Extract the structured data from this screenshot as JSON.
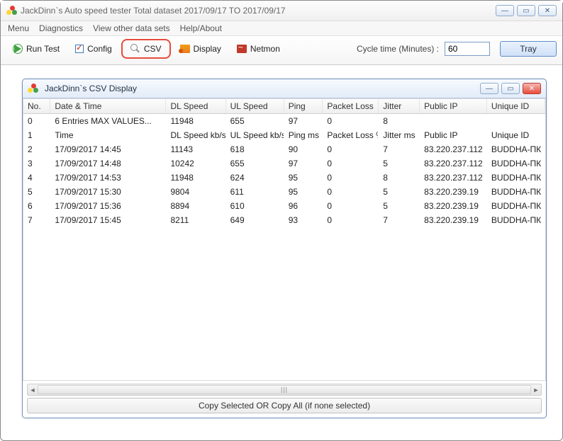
{
  "main": {
    "title": "JackDinn`s Auto speed tester     Total dataset   2017/09/17   TO   2017/09/17"
  },
  "menu": {
    "items": [
      "Menu",
      "Diagnostics",
      "View other data sets",
      "Help/About"
    ]
  },
  "toolbar": {
    "run": "Run Test",
    "config": "Config",
    "csv": "CSV",
    "display": "Display",
    "netmon": "Netmon",
    "cycle_label": "Cycle time (Minutes) :",
    "cycle_value": "60",
    "tray": "Tray"
  },
  "child": {
    "title": "JackDinn`s CSV Display",
    "copy_button": "Copy Selected  OR  Copy All (if none selected)",
    "headers": [
      "No.",
      "Date & Time",
      "DL Speed",
      "UL Speed",
      "Ping",
      "Packet Loss",
      "Jitter",
      "Public IP",
      "Unique ID"
    ],
    "rows": [
      {
        "no": "0",
        "dt": "6 Entries     MAX VALUES...",
        "dl": "11948",
        "ul": "655",
        "ping": "97",
        "pl": "0",
        "jit": "8",
        "ip": "",
        "uid": ""
      },
      {
        "no": "1",
        "dt": "Time",
        "dl": "DL Speed kb/s",
        "ul": "UL Speed kb/s",
        "ping": "Ping ms",
        "pl": "Packet Loss %",
        "jit": "Jitter ms",
        "ip": "Public IP",
        "uid": "Unique ID"
      },
      {
        "no": "2",
        "dt": "17/09/2017 14:45",
        "dl": "11143",
        "ul": "618",
        "ping": "90",
        "pl": "0",
        "jit": "7",
        "ip": "83.220.237.112",
        "uid": "BUDDHA-ПК"
      },
      {
        "no": "3",
        "dt": "17/09/2017 14:48",
        "dl": "10242",
        "ul": "655",
        "ping": "97",
        "pl": "0",
        "jit": "5",
        "ip": "83.220.237.112",
        "uid": "BUDDHA-ПК"
      },
      {
        "no": "4",
        "dt": "17/09/2017 14:53",
        "dl": "11948",
        "ul": "624",
        "ping": "95",
        "pl": "0",
        "jit": "8",
        "ip": "83.220.237.112",
        "uid": "BUDDHA-ПК"
      },
      {
        "no": "5",
        "dt": "17/09/2017 15:30",
        "dl": "9804",
        "ul": "611",
        "ping": "95",
        "pl": "0",
        "jit": "5",
        "ip": "83.220.239.19",
        "uid": "BUDDHA-ПК"
      },
      {
        "no": "6",
        "dt": "17/09/2017 15:36",
        "dl": "8894",
        "ul": "610",
        "ping": "96",
        "pl": "0",
        "jit": "5",
        "ip": "83.220.239.19",
        "uid": "BUDDHA-ПК"
      },
      {
        "no": "7",
        "dt": "17/09/2017 15:45",
        "dl": "8211",
        "ul": "649",
        "ping": "93",
        "pl": "0",
        "jit": "7",
        "ip": "83.220.239.19",
        "uid": "BUDDHA-ПК"
      }
    ]
  }
}
